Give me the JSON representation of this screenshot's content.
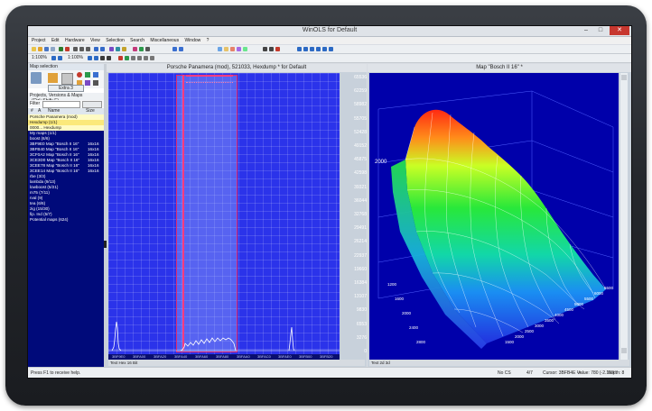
{
  "window": {
    "title": "WinOLS for Default"
  },
  "menu": [
    "Project",
    "Edit",
    "Hardware",
    "View",
    "Selection",
    "Search",
    "Miscellaneous",
    "Window",
    "?"
  ],
  "toolbar": {
    "zoom1": "1:100% ",
    "zoom2": "1:100% ",
    "mode": ""
  },
  "map_panel": {
    "header": "Map selection",
    "extra_button": "Extra 3",
    "projects_label": "Projects, Versions & Maps",
    "projects_hint": "(Ctrl+Shift+F)",
    "filter_label": "Filter",
    "columns": {
      "nr": "#",
      "a": "A",
      "name": "Name",
      "size": "Size"
    },
    "tree": [
      {
        "name": "Porsche Panamera (mod)",
        "size": "",
        "style": "hl"
      },
      {
        "name": "Hexdump (1/1)",
        "size": "",
        "style": "sel"
      },
      {
        "name": "  0000... Hexdump",
        "size": "",
        "style": "hl"
      },
      {
        "name": "  My maps (1/1)",
        "size": "",
        "style": ""
      },
      {
        "name": "  boost (6/6)",
        "size": "",
        "style": ""
      },
      {
        "name": "   3BF9E0 Map \"Bosch II 16\"",
        "size": "16x16",
        "style": ""
      },
      {
        "name": "   3BFB40 Map \"Bosch II 16\"",
        "size": "16x16",
        "style": ""
      },
      {
        "name": "   3CF0A2 Map \"Bosch II 16\"",
        "size": "16x16",
        "style": ""
      },
      {
        "name": "   3CE3D0 Map \"Bosch II 16\"",
        "size": "16x16",
        "style": ""
      },
      {
        "name": "   3CEE78 Map \"Bosch II 16\"",
        "size": "16x16",
        "style": ""
      },
      {
        "name": "   3CEE14 Map \"Bosch II 16\"",
        "size": "16x16",
        "style": ""
      },
      {
        "name": "  rbe (3/3)",
        "size": "",
        "style": ""
      },
      {
        "name": "  lambda (9/13)",
        "size": "",
        "style": ""
      },
      {
        "name": "  lowboost (5/21)",
        "size": "",
        "style": ""
      },
      {
        "name": "  m75 (7/11)",
        "size": "",
        "style": ""
      },
      {
        "name": "  rval (9)",
        "size": "",
        "style": ""
      },
      {
        "name": "  tea (6/6)",
        "size": "",
        "style": ""
      },
      {
        "name": "  zig (15/30)",
        "size": "",
        "style": ""
      },
      {
        "name": "  fip. Ind (5/7)",
        "size": "",
        "style": ""
      },
      {
        "name": "  Potential maps (624)",
        "size": "",
        "style": ""
      }
    ]
  },
  "hex_window": {
    "title": "Porsche Panamera (mod), 521033, Hexdump * for Default",
    "axis_values": [
      "65536",
      "62259",
      "58982",
      "55705",
      "52428",
      "49152",
      "45875",
      "42598",
      "39321",
      "36044",
      "32768",
      "29491",
      "26214",
      "22937",
      "19660",
      "16384",
      "13107",
      "9830",
      "6553",
      "3276",
      "0"
    ],
    "addresses": [
      "3BF9E0",
      "3BFA00",
      "3BFA20",
      "3BFA40",
      "3BFA60",
      "3BFA80",
      "3BFAA0",
      "3BFAC0",
      "3BFAE0",
      "3BFB00",
      "3BFB20"
    ],
    "status": "Text  Hex  16 Bit"
  },
  "map_window": {
    "title": "Map \"Bosch II 16\" *",
    "status": "Text  2d  3d",
    "z_label": "2000",
    "x_labels": [
      "1500",
      "2000",
      "2500",
      "3000",
      "3500",
      "4000",
      "4500",
      "5000",
      "5500",
      "6000",
      "6500"
    ],
    "y_labels": [
      "1200",
      "1600",
      "2000",
      "2400",
      "2800"
    ]
  },
  "statusbar": {
    "help": "Press F1 to receive help.",
    "checksum": "No CS",
    "count": "4/7",
    "cursor": "Cursor: 3BFB4E ->",
    "value": "Value: 780 (-2.1%)",
    "width": "Width: 8"
  },
  "colors": {
    "hex_bg": "#2b33ea",
    "tree_bg": "#000a7a",
    "selection": "#ff3b7f",
    "map_bg": "#0000aa"
  }
}
